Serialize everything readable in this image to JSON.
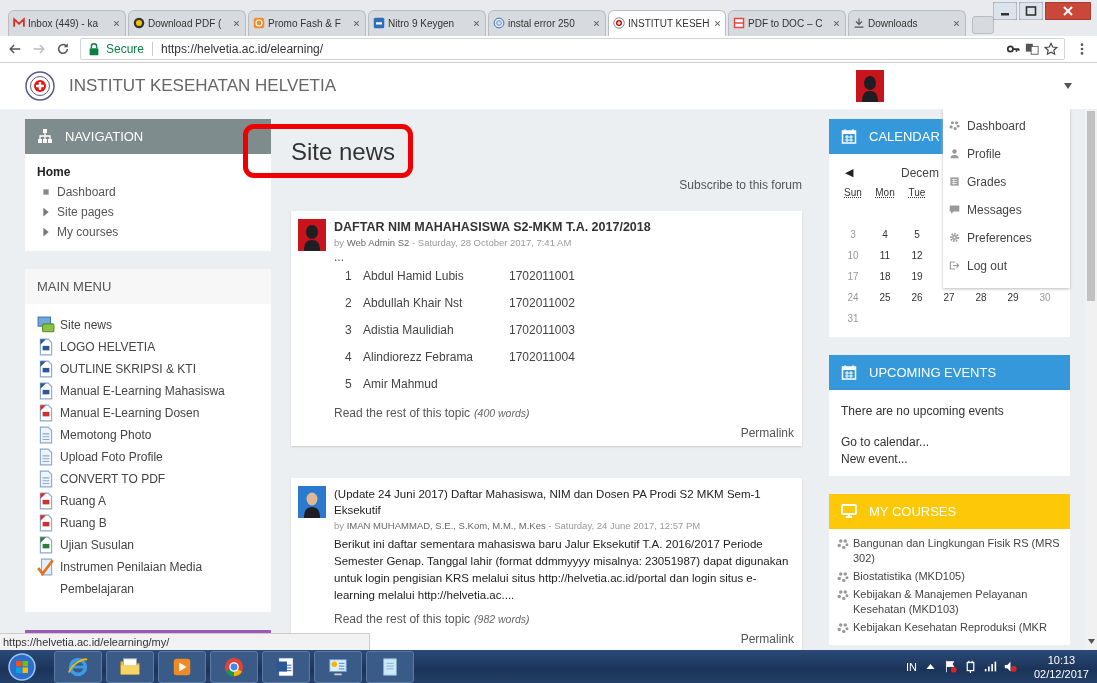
{
  "browser": {
    "tabs": [
      {
        "title": "Inbox (449) - ka",
        "kind": "mail",
        "selected": false
      },
      {
        "title": "Download PDF (",
        "kind": "emblem",
        "selected": false
      },
      {
        "title": "Promo Fash & F",
        "kind": "orange",
        "selected": false
      },
      {
        "title": "Nitro 9 Keygen",
        "kind": "box",
        "selected": false
      },
      {
        "title": "instal error 250",
        "kind": "globe",
        "selected": false
      },
      {
        "title": "INSTITUT KESEH",
        "kind": "crest",
        "selected": true
      },
      {
        "title": "PDF to DOC – C",
        "kind": "pdfdoc",
        "selected": false
      },
      {
        "title": "Downloads",
        "kind": "download",
        "selected": false
      }
    ],
    "secure_label": "Secure",
    "url": "https://helvetia.ac.id/elearning/"
  },
  "header": {
    "title": "INSTITUT KESEHATAN HELVETIA"
  },
  "navigation": {
    "title": "NAVIGATION",
    "items": [
      {
        "label": "Home",
        "kind": "home"
      },
      {
        "label": "Dashboard",
        "kind": "leaf"
      },
      {
        "label": "Site pages",
        "kind": "branch",
        "expanded": false
      },
      {
        "label": "My courses",
        "kind": "branch",
        "expanded": false
      }
    ]
  },
  "main_menu": {
    "title": "MAIN MENU",
    "items": [
      {
        "label": "Site news",
        "kind": "forum"
      },
      {
        "label": "LOGO HELVETIA",
        "kind": "word"
      },
      {
        "label": "OUTLINE SKRIPSI & KTI",
        "kind": "word"
      },
      {
        "label": "Manual E-Learning Mahasiswa",
        "kind": "word"
      },
      {
        "label": "Manual E-Learning Dosen",
        "kind": "pdf"
      },
      {
        "label": "Memotong Photo",
        "kind": "page"
      },
      {
        "label": "Upload Foto Profile",
        "kind": "page"
      },
      {
        "label": "CONVERT TO PDF",
        "kind": "page"
      },
      {
        "label": "Ruang A",
        "kind": "pdf"
      },
      {
        "label": "Ruang B",
        "kind": "pdf"
      },
      {
        "label": "Ujian Susulan",
        "kind": "excel"
      },
      {
        "label": "Instrumen Penilaian Media Pembelajaran",
        "kind": "checklist"
      }
    ]
  },
  "page_title": "Site news",
  "subscribe_link": "Subscribe to this forum",
  "posts": [
    {
      "title": "DAFTAR NIM MAHAHASISWA S2-MKM T.A. 2017/2018",
      "by": "by",
      "author": "Web Admin S2",
      "date": "- Saturday, 28 October 2017, 7:41 AM",
      "body": {
        "kind": "list",
        "lead": "...",
        "rows": [
          {
            "num": "1",
            "name": "Abdul Hamid Lubis",
            "nim": "1702011001"
          },
          {
            "num": "2",
            "name": "Abdullah Khair Nst",
            "nim": "1702011002"
          },
          {
            "num": "3",
            "name": "Adistia Maulidiah",
            "nim": "1702011003"
          },
          {
            "num": "4",
            "name": "Alindiorezz Febrama",
            "nim": "1702011004"
          },
          {
            "num": "5",
            "name": "Amir Mahmud"
          }
        ]
      },
      "read_more": "Read the rest of this topic",
      "word_count": "(400 words)",
      "permalink": "Permalink"
    },
    {
      "title": "(Update 24 Juni 2017) Daftar Mahasiswa, NIM dan Dosen PA Prodi S2 MKM Sem-1 Eksekutif",
      "by": "by",
      "author": "IMAN MUHAMMAD, S.E., S.Kom, M.M., M.Kes",
      "date": "- Saturday, 24 June 2017, 12:57 PM",
      "body": {
        "kind": "text",
        "text": "Berikut ini daftar sementara mahasiswa baru Jalur Eksekutif T.A. 2016/2017 Periode Semester Genap. Tanggal lahir (format ddmmyyyy misalnya: 23051987) dapat digunakan untuk login pengisian KRS melalui situs http://helvetia.ac.id/portal dan login situs e-learning melalui http://helvetia.ac...."
      },
      "read_more": "Read the rest of this topic",
      "word_count": "(982 words)",
      "permalink": "Permalink"
    }
  ],
  "calendar": {
    "title": "CALENDAR",
    "prev": "◀",
    "month": "Decem",
    "weekdays": [
      "Sun",
      "Mon",
      "Tue"
    ],
    "weeks": [
      [
        {
          "day": "3",
          "weekend": true
        },
        {
          "day": "4",
          "weekend": false
        },
        {
          "day": "5",
          "weekend": false
        }
      ],
      [
        {
          "day": "10",
          "weekend": true
        },
        {
          "day": "11",
          "weekend": false
        },
        {
          "day": "12",
          "weekend": false
        }
      ],
      [
        {
          "day": "17",
          "weekend": true
        },
        {
          "day": "18",
          "weekend": false
        },
        {
          "day": "19",
          "weekend": false
        }
      ],
      [
        {
          "day": "24",
          "weekend": true
        },
        {
          "day": "25",
          "weekend": false
        },
        {
          "day": "26",
          "weekend": false
        },
        {
          "day": "27",
          "weekend": false
        },
        {
          "day": "28",
          "weekend": false
        },
        {
          "day": "29",
          "weekend": false
        },
        {
          "day": "30",
          "weekend": true
        }
      ],
      [
        {
          "day": "31",
          "weekend": true
        }
      ]
    ]
  },
  "user_menu": [
    {
      "kind": "dashboard",
      "label": "Dashboard"
    },
    {
      "kind": "profile",
      "label": "Profile"
    },
    {
      "kind": "grades",
      "label": "Grades"
    },
    {
      "kind": "messages",
      "label": "Messages"
    },
    {
      "kind": "preferences",
      "label": "Preferences"
    },
    {
      "kind": "logout",
      "label": "Log out"
    }
  ],
  "upcoming_events": {
    "title": "UPCOMING EVENTS",
    "message": "There are no upcoming events",
    "links": [
      "Go to calendar...",
      "New event..."
    ]
  },
  "my_courses": {
    "title": "MY COURSES",
    "items": [
      "Bangunan dan Lingkungan Fisik RS (MRS 302)",
      "Biostatistika (MKD105)",
      "Kebijakan & Manajemen Pelayanan Kesehatan (MKD103)",
      "Kebijakan Kesehatan Reproduksi (MKR"
    ]
  },
  "status_url": "https://helvetia.ac.id/elearning/my/",
  "taskbar": {
    "language": "IN",
    "time": "10:13",
    "date": "02/12/2017"
  }
}
